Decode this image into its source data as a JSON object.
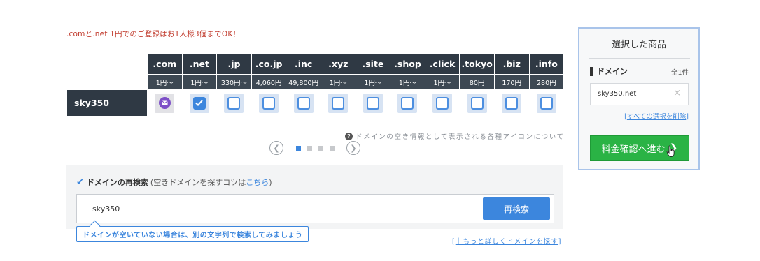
{
  "promo_text": ".comと.net 1円でのご登録はお1人様3個までOK！",
  "tlds": [
    ".com",
    ".net",
    ".jp",
    ".co.jp",
    ".inc",
    ".xyz",
    ".site",
    ".shop",
    ".click",
    ".tokyo",
    ".biz",
    ".info"
  ],
  "prices": [
    "1円〜",
    "1円〜",
    "330円〜",
    "4,060円",
    "49,800円",
    "1円〜",
    "1円〜",
    "1円〜",
    "1円〜",
    "80円",
    "170円",
    "280円"
  ],
  "row": {
    "label": "sky350",
    "states": [
      "mail",
      "checked",
      "unchecked",
      "unchecked",
      "unchecked",
      "unchecked",
      "unchecked",
      "unchecked",
      "unchecked",
      "unchecked",
      "unchecked",
      "unchecked"
    ]
  },
  "icon_note": "ドメインの空き情報として表示される各種アイコンについて",
  "pager": {
    "pages": 4,
    "active": 1
  },
  "search": {
    "title": "ドメインの再検索",
    "hint_prefix": "(空きドメインを探すコツは",
    "hint_link": "こちら",
    "hint_suffix": ")",
    "value": "sky350",
    "button": "再検索",
    "tip": "ドメインが空いていない場合は、別の文字列で検索してみましょう",
    "more_link_open": "[",
    "more_link": "｜もっと詳しくドメインを探す",
    "more_link_close": "]"
  },
  "cart": {
    "title": "選択した商品",
    "category": "ドメイン",
    "count": "全1件",
    "item": "sky350.net",
    "remove_icon": "×",
    "clear_open": "[",
    "clear_link": "すべての選択を削除",
    "clear_close": "]",
    "proceed": "料金確認へ進む",
    "proceed_chevron": "❯"
  },
  "colors": {
    "accent": "#3c86dd",
    "dark_header": "#2f3944",
    "proceed": "#2ab345",
    "promo": "#c0392b"
  }
}
